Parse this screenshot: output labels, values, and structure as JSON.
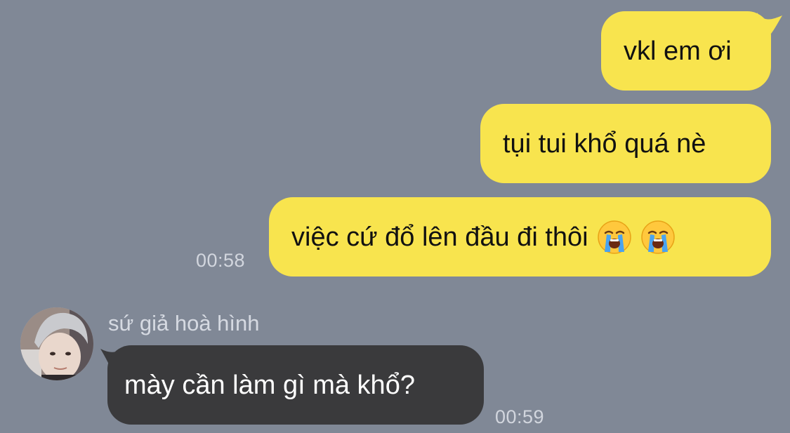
{
  "conversation": {
    "outgoing": [
      {
        "text": "vkl em ơi"
      },
      {
        "text": "tụi tui khổ quá nè"
      },
      {
        "text": "việc cứ đổ lên đầu đi thôi",
        "emojis": [
          "loudly-crying-face-icon",
          "loudly-crying-face-icon"
        ]
      }
    ],
    "outgoing_time": "00:58",
    "incoming": {
      "sender": "sứ giả hoà hình",
      "text": "mày cần làm gì mà khổ?",
      "time": "00:59"
    }
  },
  "colors": {
    "background": "#808896",
    "outgoing_bubble": "#F8E44E",
    "incoming_bubble": "#3A3A3C",
    "timestamp": "#D2D6DE"
  }
}
